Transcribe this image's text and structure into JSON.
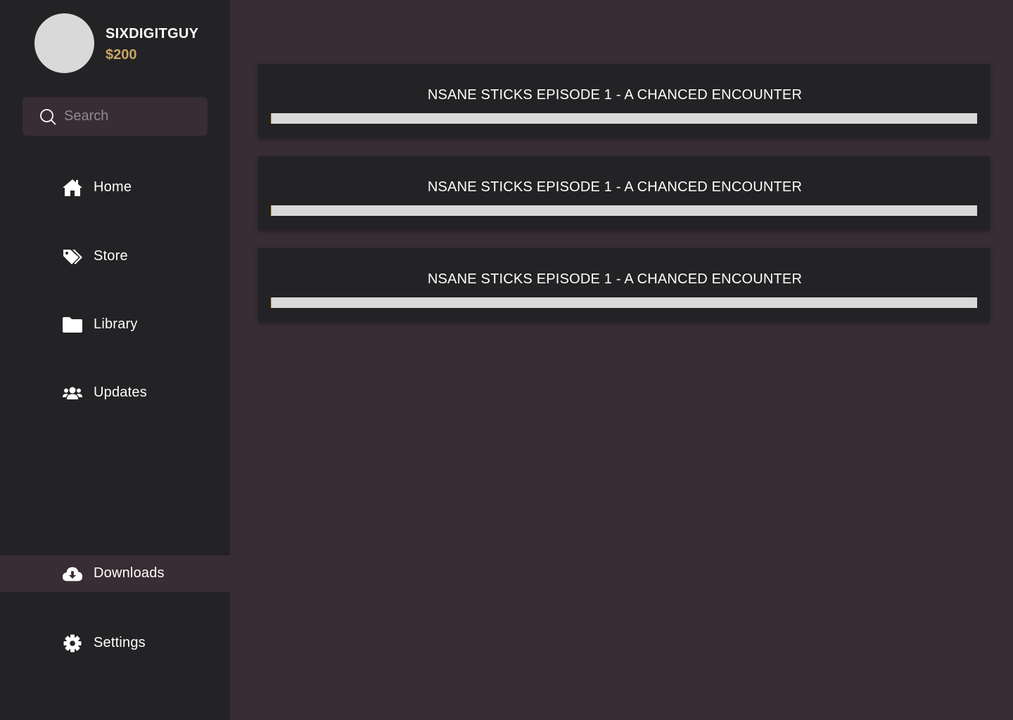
{
  "user": {
    "name": "SIXDIGITGUY",
    "balance": "$200"
  },
  "search": {
    "placeholder": "Search",
    "value": ""
  },
  "nav": {
    "items": [
      {
        "label": "Home",
        "icon": "home-icon"
      },
      {
        "label": "Store",
        "icon": "tags-icon"
      },
      {
        "label": "Library",
        "icon": "folder-icon"
      },
      {
        "label": "Updates",
        "icon": "users-icon"
      },
      {
        "label": "Downloads",
        "icon": "cloud-download-icon",
        "active": true
      },
      {
        "label": "Settings",
        "icon": "gear-icon"
      }
    ]
  },
  "downloads": [
    {
      "title": "NSANE STICKS EPISODE 1 - A CHANCED ENCOUNTER",
      "progress": 0.001
    },
    {
      "title": "NSANE STICKS EPISODE 1 - A CHANCED ENCOUNTER",
      "progress": 0.001
    },
    {
      "title": "NSANE STICKS EPISODE 1 - A CHANCED ENCOUNTER",
      "progress": 0.001
    }
  ],
  "colors": {
    "sidebar": "#232224",
    "background": "#372d33",
    "accent": "#c9a462",
    "progress_track": "#d9d9d9"
  }
}
